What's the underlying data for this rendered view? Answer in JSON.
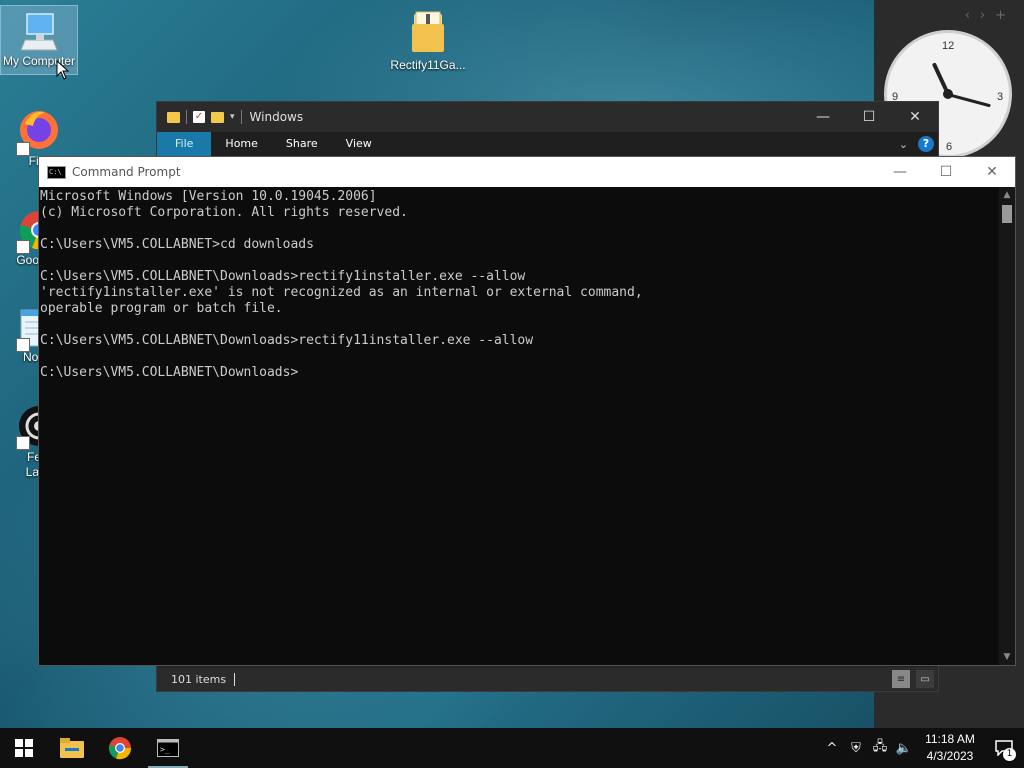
{
  "desktop": {
    "icons": [
      {
        "label": "My Computer"
      },
      {
        "label": "Rectify11Ga..."
      },
      {
        "label": "Fire"
      },
      {
        "label": "Goo Chr"
      },
      {
        "label": "Notep"
      },
      {
        "label": "Feat Laun"
      }
    ]
  },
  "clock_widget": {
    "numerals": [
      "12",
      "3",
      "6",
      "9"
    ],
    "nav": [
      "‹",
      "›",
      "+"
    ]
  },
  "explorer": {
    "title": "Windows",
    "ribbon_tabs": [
      "File",
      "Home",
      "Share",
      "View"
    ],
    "help": "?",
    "status": "101 items"
  },
  "cmd": {
    "title": "Command Prompt",
    "lines": [
      "Microsoft Windows [Version 10.0.19045.2006]",
      "(c) Microsoft Corporation. All rights reserved.",
      "",
      "C:\\Users\\VM5.COLLABNET>cd downloads",
      "",
      "C:\\Users\\VM5.COLLABNET\\Downloads>rectify1installer.exe --allow",
      "'rectify1installer.exe' is not recognized as an internal or external command,",
      "operable program or batch file.",
      "",
      "C:\\Users\\VM5.COLLABNET\\Downloads>rectify11installer.exe --allow",
      "",
      "C:\\Users\\VM5.COLLABNET\\Downloads>"
    ]
  },
  "taskbar": {
    "time": "11:18 AM",
    "date": "4/3/2023",
    "notification_count": "1"
  },
  "colors": {
    "accent": "#1979a9",
    "console_bg": "#0c0c0c",
    "console_fg": "#cccccc"
  }
}
